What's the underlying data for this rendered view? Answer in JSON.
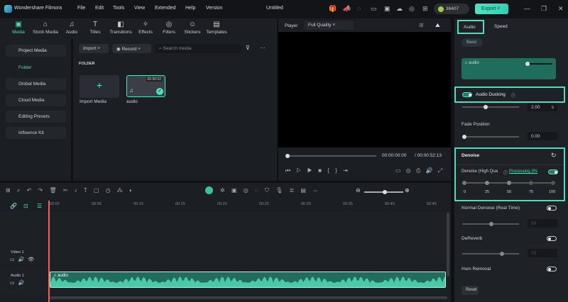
{
  "app": {
    "name": "Wondershare Filmora",
    "project_title": "Untitled",
    "credits": "36407",
    "export_label": "Export"
  },
  "menu": [
    "File",
    "Edit",
    "Tools",
    "View",
    "Extended",
    "Help",
    "Version"
  ],
  "toolbar": [
    {
      "label": "Media",
      "icon": "media-icon"
    },
    {
      "label": "Stock Media",
      "icon": "stock-media-icon"
    },
    {
      "label": "Audio",
      "icon": "music-icon"
    },
    {
      "label": "Titles",
      "icon": "title-icon"
    },
    {
      "label": "Transitions",
      "icon": "transition-icon"
    },
    {
      "label": "Effects",
      "icon": "effects-icon"
    },
    {
      "label": "Filters",
      "icon": "filter-icon"
    },
    {
      "label": "Stickers",
      "icon": "sticker-icon"
    },
    {
      "label": "Templates",
      "icon": "template-icon"
    }
  ],
  "leftnav": {
    "project_media": "Project Media",
    "folder": "Folder",
    "global_media": "Global Media",
    "cloud_media": "Cloud Media",
    "editing_presets": "Editing Presets",
    "influence_kit": "Influence Kit"
  },
  "media": {
    "import": "Import",
    "record": "Record",
    "search_placeholder": "Search media",
    "folder_heading": "FOLDER",
    "import_media": "Import Media",
    "clip_name": "audio",
    "clip_duration": "00:00:52"
  },
  "player": {
    "label": "Player",
    "quality": "Full Quality",
    "current_time": "00:00:00:00",
    "total_time": "00:00:52:13",
    "progress": 0
  },
  "right": {
    "tabs": [
      "Audio",
      "Speed"
    ],
    "subtab": "Basic",
    "clip_name": "audio",
    "audio_ducking": "Audio Ducking",
    "ducking_value": "2.00",
    "ducking_unit": "s",
    "fade_position": "Fade Position",
    "fade_value": "0.00",
    "denoise": "Denoise",
    "hq_denoise": "Denoise (High Qua",
    "processing": "Processing 3%",
    "scale": [
      "0",
      "25",
      "50",
      "75",
      "100"
    ],
    "normal_denoise": "Normal Denoise (Real Time)",
    "normal_value": "50",
    "dereverb": "DeReverb",
    "dereverb_value": "70",
    "hum_removal": "Hum Removal",
    "reset": "Reset"
  },
  "timeline": {
    "ticks": [
      "00:00",
      "00:05",
      "00:10",
      "00:15",
      "00:20",
      "00:25",
      "00:30",
      "00:35",
      "00:40",
      "00:45"
    ],
    "video_track": "Video 1",
    "audio_track": "Audio 1",
    "audio_clip": "audio"
  },
  "colors": {
    "accent": "#52dcbe",
    "wave": "#1f6e5c"
  }
}
